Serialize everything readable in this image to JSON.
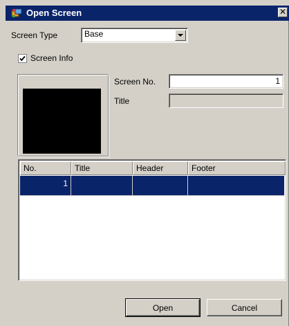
{
  "window": {
    "title": "Open Screen",
    "close_glyph": "✕"
  },
  "screen_type": {
    "label": "Screen Type",
    "value": "Base"
  },
  "screen_info": {
    "label": "Screen Info",
    "checked": true
  },
  "screen_no": {
    "label": "Screen No.",
    "value": "1"
  },
  "title_field": {
    "label": "Title",
    "value": ""
  },
  "table": {
    "columns": [
      "No.",
      "Title",
      "Header",
      "Footer"
    ],
    "rows": [
      {
        "no": "1",
        "title": "",
        "header": "",
        "footer": ""
      }
    ]
  },
  "buttons": {
    "open": "Open",
    "cancel": "Cancel"
  },
  "colors": {
    "titlebar": "#0a246a",
    "face": "#d4d0c8",
    "selection": "#0a246a"
  },
  "icons": {
    "title": "open-screen-icon",
    "checkbox": "check-icon",
    "dropdown": "chevron-down-icon",
    "close": "close-icon"
  }
}
